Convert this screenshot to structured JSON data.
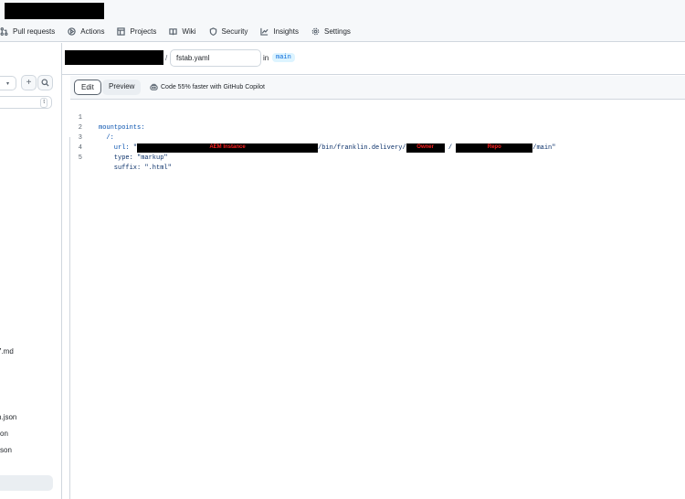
{
  "nav": {
    "items": [
      {
        "label": "Pull requests",
        "icon": "pull-request-icon"
      },
      {
        "label": "Actions",
        "icon": "play-icon"
      },
      {
        "label": "Projects",
        "icon": "table-icon"
      },
      {
        "label": "Wiki",
        "icon": "book-icon"
      },
      {
        "label": "Security",
        "icon": "shield-icon"
      },
      {
        "label": "Insights",
        "icon": "graph-icon"
      },
      {
        "label": "Settings",
        "icon": "gear-icon"
      }
    ]
  },
  "sidebar": {
    "add_button": "+",
    "filter_shortcut": "t",
    "files": [
      ".md",
      ".json",
      "on",
      "son"
    ]
  },
  "path": {
    "separator": "/",
    "filename": "fstab.yaml",
    "in_label": "in",
    "branch": "main"
  },
  "editor": {
    "tab_edit": "Edit",
    "tab_preview": "Preview",
    "copilot_text": "Code 55% faster with GitHub Copilot"
  },
  "code": {
    "line_numbers": [
      "1",
      "2",
      "3",
      "4",
      "5"
    ],
    "l1": "mountpoints:",
    "l2": "  /:",
    "l3_key": "    url: ",
    "l3_q": "\"",
    "redact_aem": "AEM Instance",
    "l3_mid": "/bin/franklin.delivery/",
    "redact_owner": "Owner",
    "l3_sep": " / ",
    "redact_repo": "Repo",
    "l3_end": "/main\"",
    "l4": "    type: \"markup\"",
    "l5": "    suffix: \".html\""
  },
  "colors": {
    "redaction_text": "#ff2020",
    "branch_bg": "#ddf4ff",
    "branch_fg": "#0969da"
  }
}
